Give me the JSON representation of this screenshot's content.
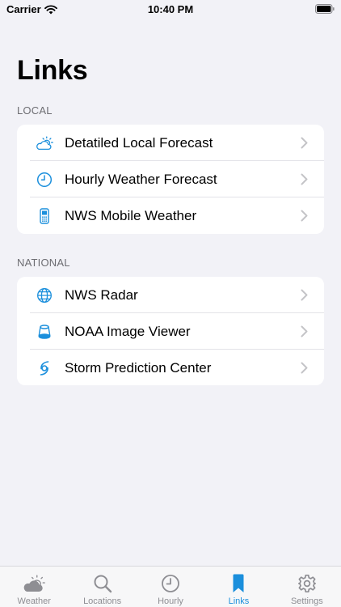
{
  "status_bar": {
    "carrier": "Carrier",
    "time": "10:40 PM"
  },
  "page": {
    "title": "Links"
  },
  "sections": [
    {
      "header": "LOCAL",
      "items": [
        {
          "label": "Detatiled Local Forecast",
          "icon": "partly-cloudy-icon"
        },
        {
          "label": "Hourly Weather Forecast",
          "icon": "clock-icon"
        },
        {
          "label": "NWS Mobile Weather",
          "icon": "mobile-phone-icon"
        }
      ]
    },
    {
      "header": "NATIONAL",
      "items": [
        {
          "label": "NWS Radar",
          "icon": "globe-icon"
        },
        {
          "label": "NOAA Image Viewer",
          "icon": "satellite-icon"
        },
        {
          "label": "Storm Prediction Center",
          "icon": "hurricane-icon"
        }
      ]
    }
  ],
  "tabs": [
    {
      "label": "Weather",
      "icon": "partly-cloudy-icon",
      "active": false
    },
    {
      "label": "Locations",
      "icon": "search-icon",
      "active": false
    },
    {
      "label": "Hourly",
      "icon": "clock-icon",
      "active": false
    },
    {
      "label": "Links",
      "icon": "bookmark-icon",
      "active": true
    },
    {
      "label": "Settings",
      "icon": "gear-icon",
      "active": false
    }
  ],
  "colors": {
    "accent": "#1b8fdc",
    "background": "#f2f2f7",
    "inactive": "#8e8e93"
  }
}
